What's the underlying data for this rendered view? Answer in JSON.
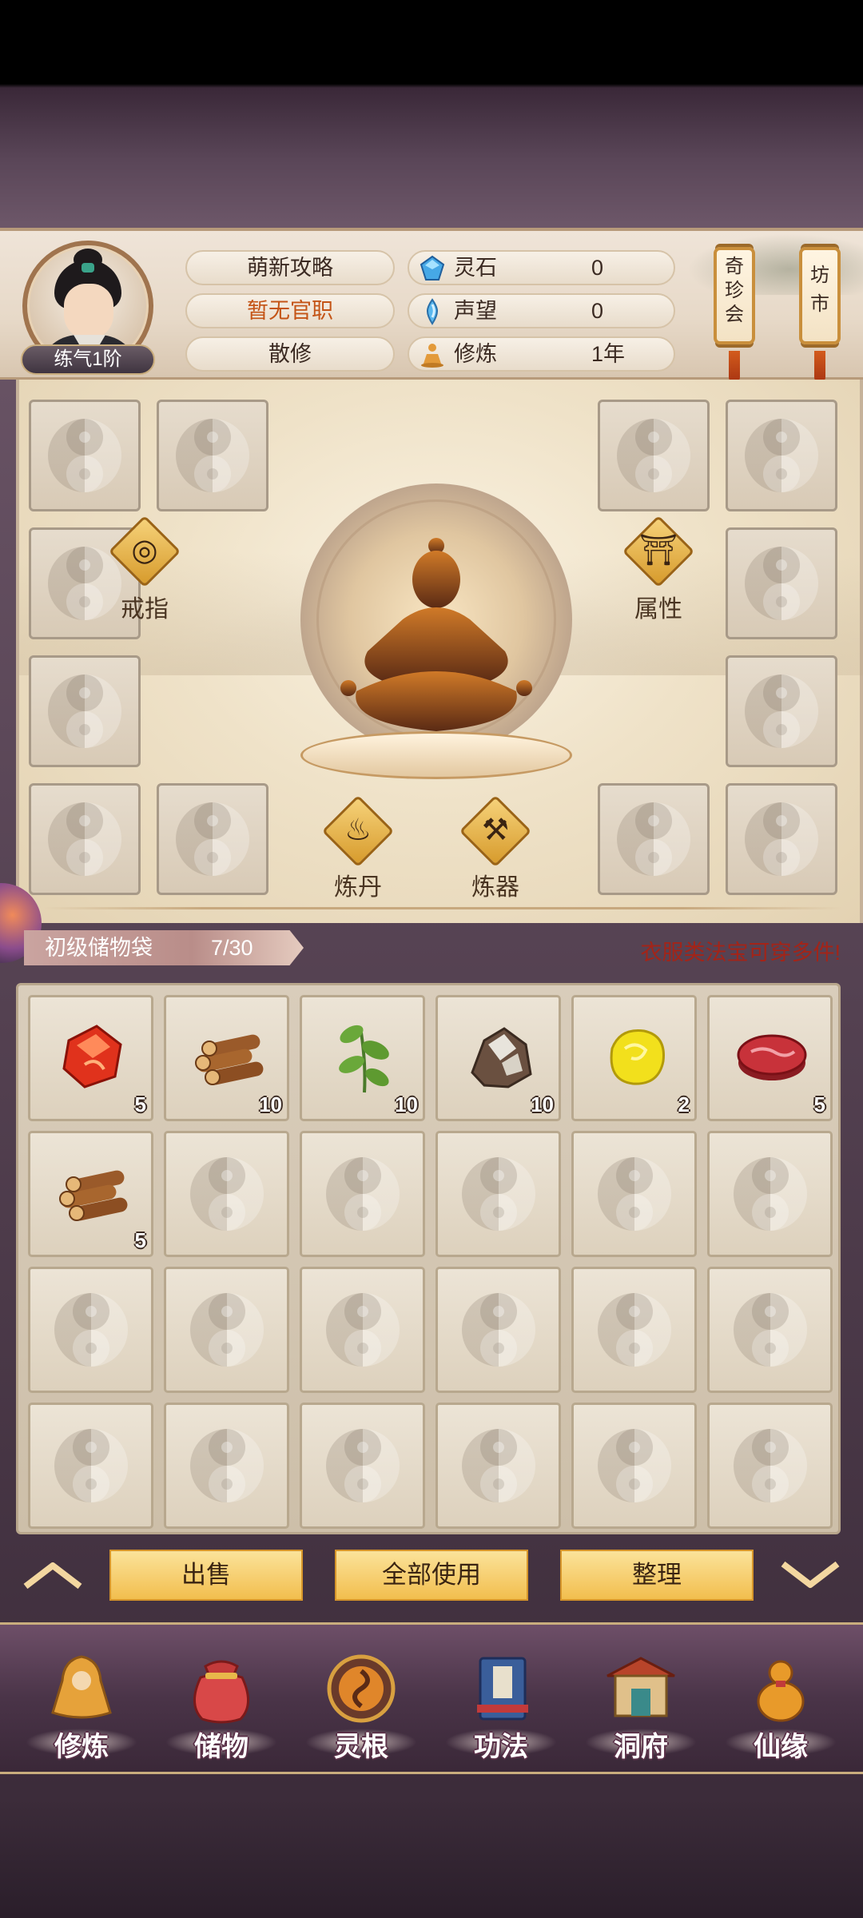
{
  "header": {
    "rank": "练气1阶",
    "guide": "萌新攻略",
    "office": "暂无官职",
    "sect": "散修",
    "resources": [
      {
        "label": "灵石",
        "value": "0",
        "icon": "spirit-stone-icon"
      },
      {
        "label": "声望",
        "value": "0",
        "icon": "prestige-icon"
      },
      {
        "label": "修炼",
        "value": "1年",
        "icon": "meditation-icon"
      }
    ],
    "scrolls": [
      "奇珍会",
      "坊市"
    ]
  },
  "equipment": {
    "ring_label": "戒指",
    "attr_label": "属性",
    "alchemy_label": "炼丹",
    "forge_label": "炼器"
  },
  "bag": {
    "name": "初级储物袋",
    "capacity": "7/30",
    "hint": "衣服类法宝可穿多件!",
    "items": [
      {
        "icon": "red-gem-icon",
        "count": "5"
      },
      {
        "icon": "wood-logs-icon",
        "count": "10"
      },
      {
        "icon": "herb-icon",
        "count": "10"
      },
      {
        "icon": "ore-icon",
        "count": "10"
      },
      {
        "icon": "yellow-stone-icon",
        "count": "2"
      },
      {
        "icon": "meat-icon",
        "count": "5"
      },
      {
        "icon": "wood-logs-icon",
        "count": "5"
      }
    ]
  },
  "actions": {
    "sell": "出售",
    "use_all": "全部使用",
    "sort": "整理"
  },
  "nav": [
    {
      "label": "修炼",
      "icon": "cultivate-icon"
    },
    {
      "label": "储物",
      "icon": "storage-bag-icon"
    },
    {
      "label": "灵根",
      "icon": "spirit-root-icon"
    },
    {
      "label": "功法",
      "icon": "technique-book-icon"
    },
    {
      "label": "洞府",
      "icon": "cave-residence-icon"
    },
    {
      "label": "仙缘",
      "icon": "immortal-fate-icon"
    }
  ],
  "colors": {
    "accent_gold": "#f2be4e",
    "hint_red": "#a32418",
    "office_orange": "#c45416"
  }
}
